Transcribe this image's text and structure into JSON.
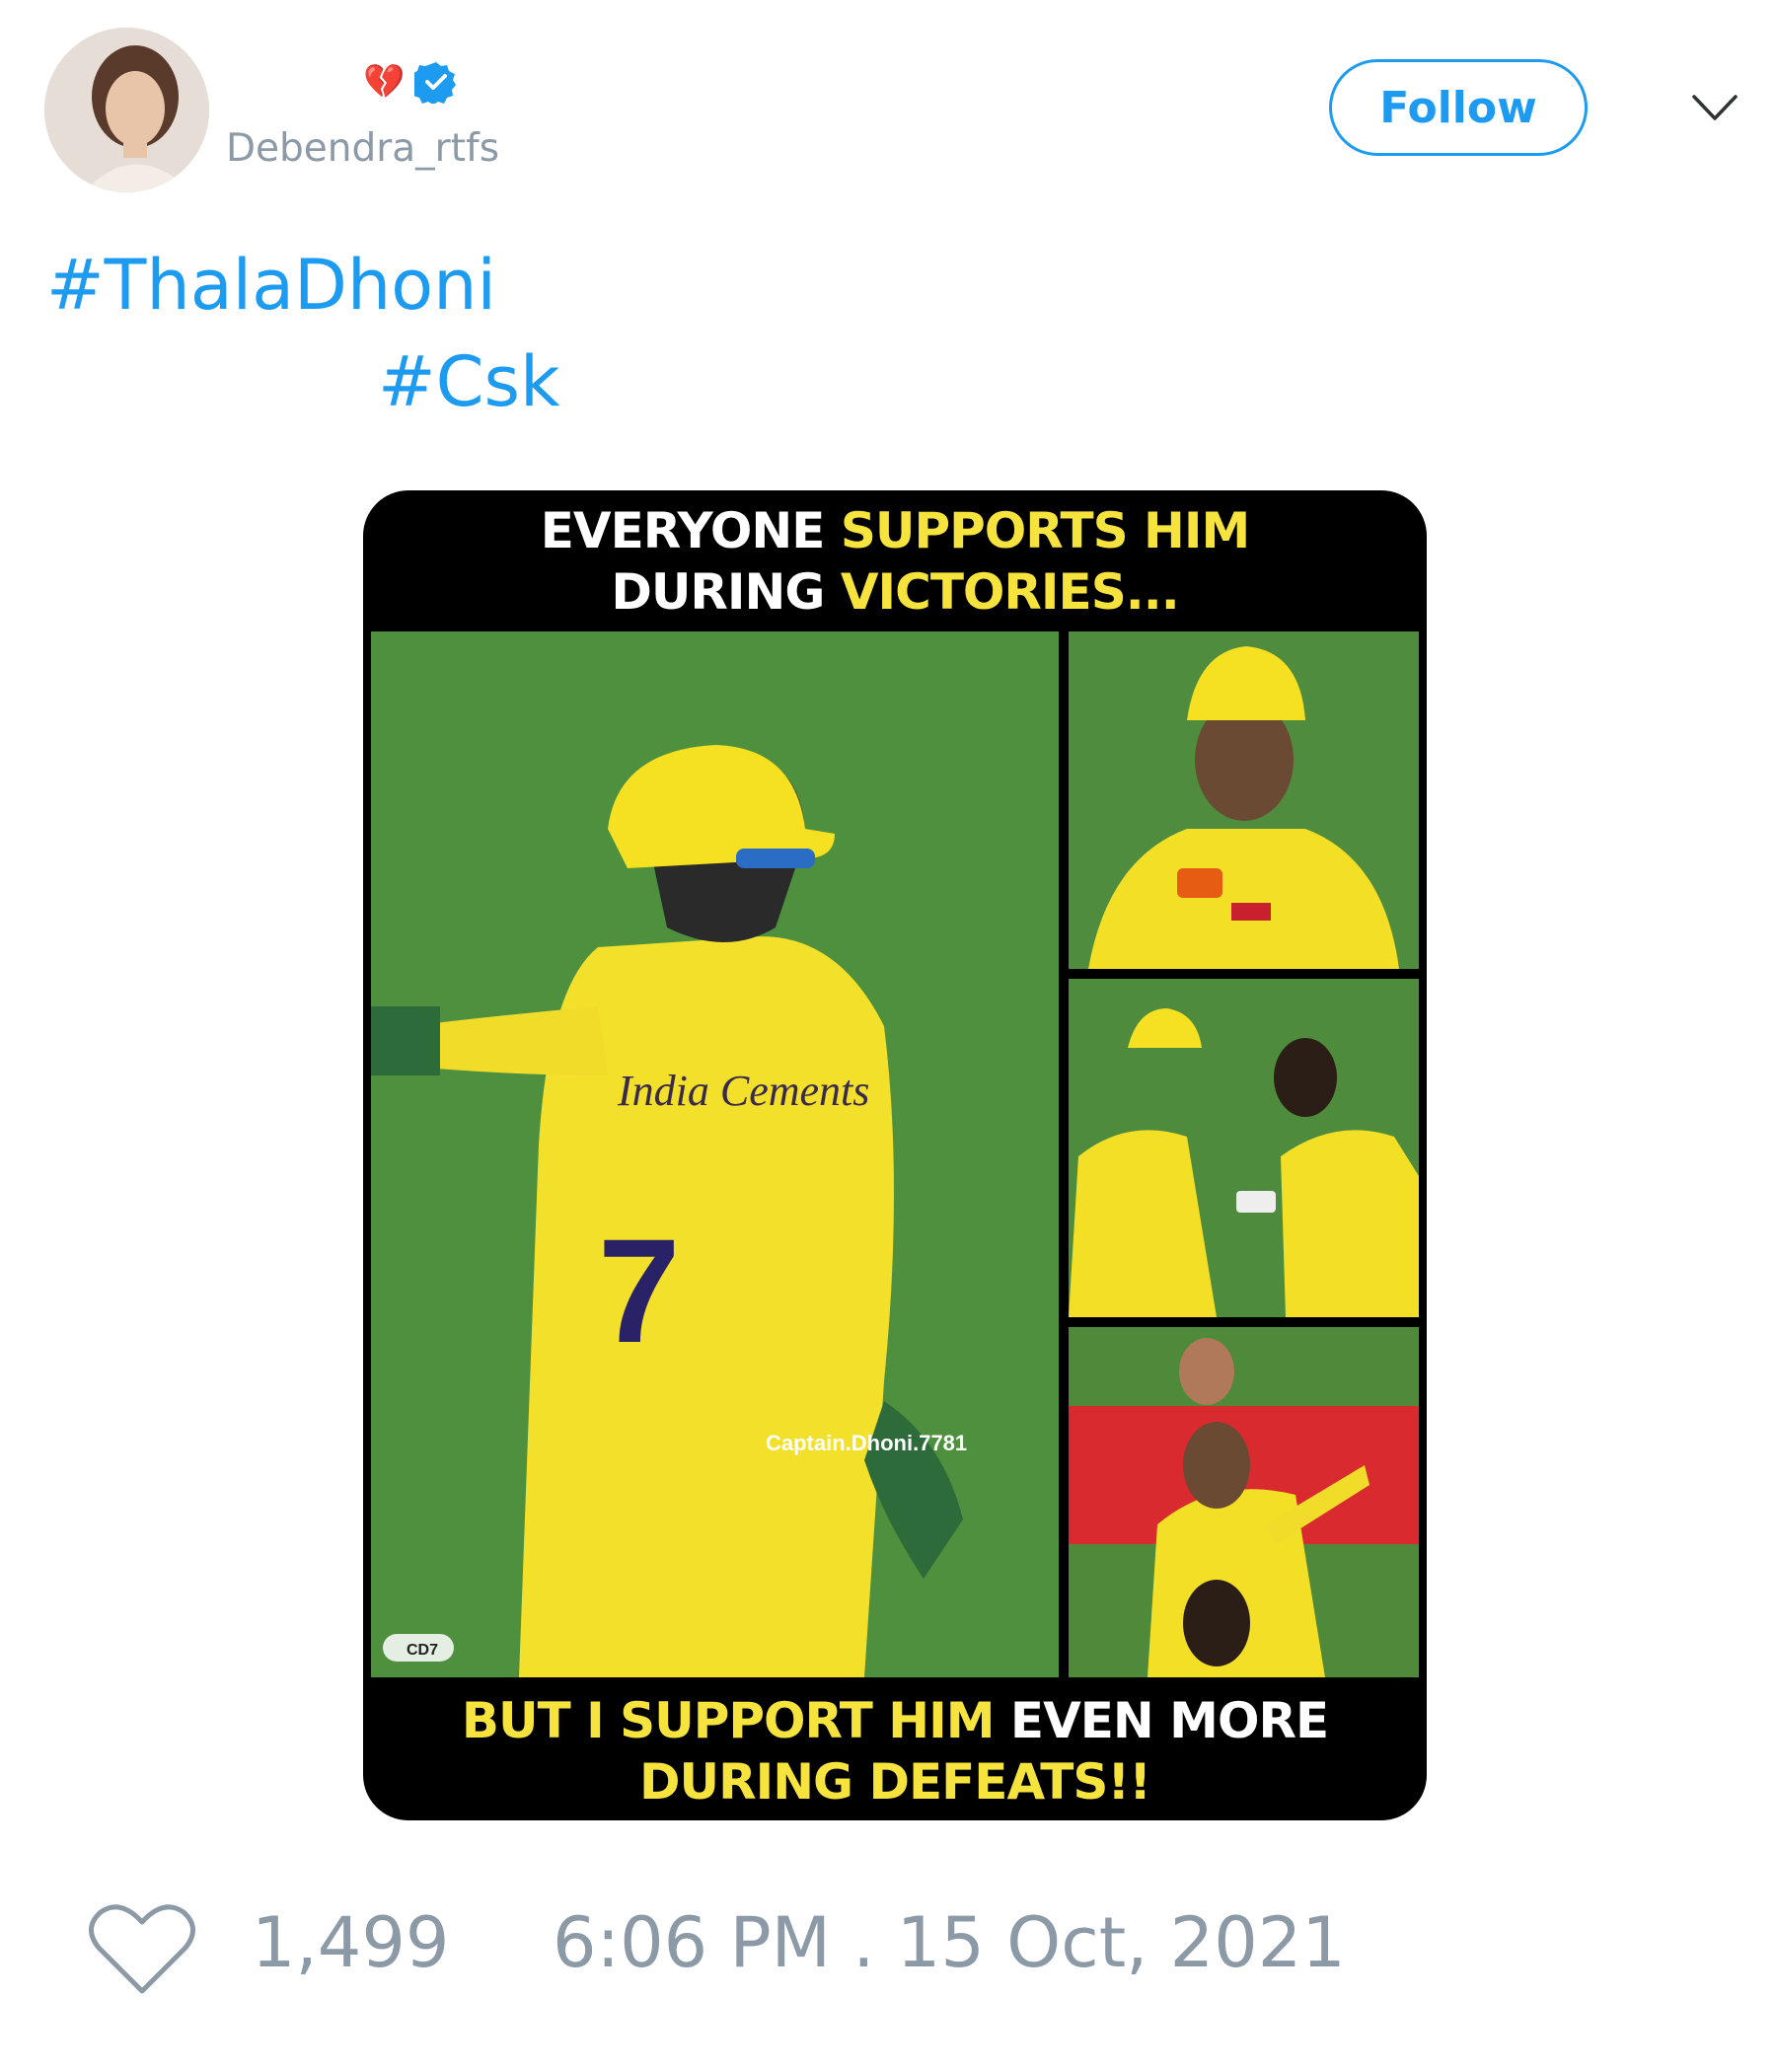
{
  "header": {
    "display_name_emoji": "💔",
    "handle": "Debendra_rtfs",
    "follow_label": "Follow"
  },
  "tweet": {
    "hashtags": [
      "#ThalaDhoni",
      "#Csk"
    ]
  },
  "meme": {
    "top_caption_line1_white": "EVERYONE ",
    "top_caption_line1_yellow": "SUPPORTS HIM",
    "top_caption_line2_white": "DURING ",
    "top_caption_line2_yellow": "VICTORIES...",
    "bottom_caption_line1_yellow": "BUT I SUPPORT HIM ",
    "bottom_caption_line1_white": "EVEN MORE",
    "bottom_caption_line2_yellow": "DURING DEFEATS!!",
    "jersey_sponsor": "India Cements",
    "jersey_number": "7",
    "watermark": "Captain.Dhoni.7781",
    "watermark_small": "CD7"
  },
  "footer": {
    "like_count": "1,499",
    "timestamp": "6:06 PM . 15 Oct, 2021"
  },
  "colors": {
    "accent": "#1d9bf0",
    "muted": "#8c99a6",
    "csk_yellow": "#f6e33d"
  }
}
